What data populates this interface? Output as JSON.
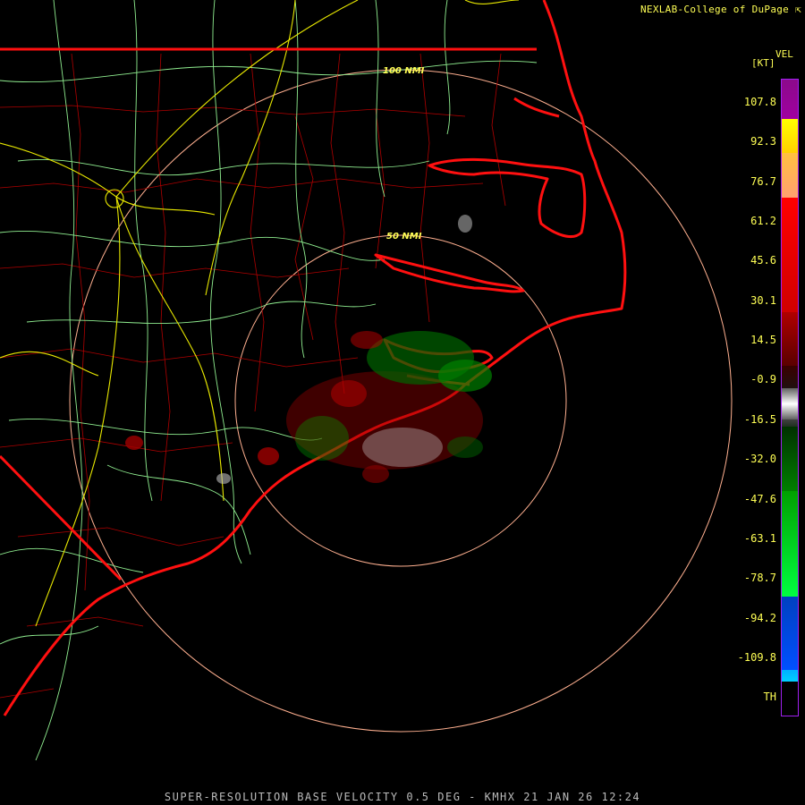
{
  "credit": "NEXLAB-College of DuPage",
  "credit_icon": "external-link-icon",
  "legend": {
    "product": "VEL",
    "units": "[KT]",
    "ticks": [
      "107.8",
      "92.3",
      "76.7",
      "61.2",
      "45.6",
      "30.1",
      "14.5",
      "-0.9",
      "-16.5",
      "-32.0",
      "-47.6",
      "-63.1",
      "-78.7",
      "-94.2",
      "-109.8",
      "TH"
    ],
    "colors": {
      "purple": "#8b0a8b",
      "yellow": "#ffff00",
      "orange": "#ffa070",
      "red": "#ff0000",
      "darkred": "#8b0000",
      "gray": "#a0a0a0",
      "darkgreen": "#006400",
      "green": "#00ff40",
      "blue": "#0050ff",
      "cyan": "#00b0ff"
    }
  },
  "rings": {
    "inner_label": "50 NMI",
    "outer_label": "100 NMI"
  },
  "footer": "SUPER-RESOLUTION BASE VELOCITY 0.5 DEG - KMHX 21 JAN 26 12:24"
}
